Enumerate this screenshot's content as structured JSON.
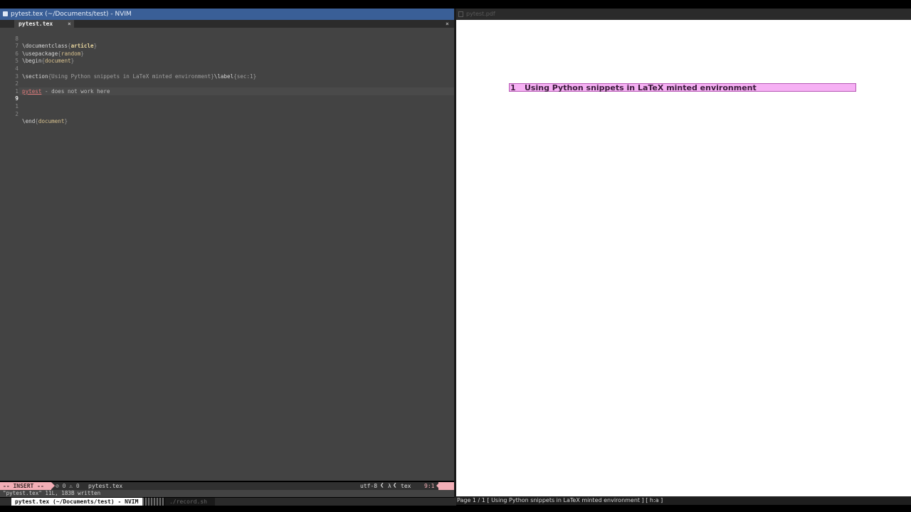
{
  "left_window": {
    "title": "pytest.tex (~/Documents/test) - NVIM",
    "tab_label": "pytest.tex",
    "tab_close": "×",
    "close_all": "×",
    "lines": [
      {
        "num": "8",
        "cmd": "\\documentclass",
        "open": "{",
        "arg": "article",
        "close": "}"
      },
      {
        "num": "7",
        "cmd": "\\usepackage",
        "open": "{",
        "arg": "random",
        "close": "}"
      },
      {
        "num": "6",
        "cmd": "\\begin",
        "open": "{",
        "arg": "document",
        "close": "}"
      },
      {
        "num": "5"
      },
      {
        "num": "4",
        "cmd": "\\section",
        "open": "{",
        "arg": "Using Python snippets in LaTeX minted environment",
        "close": "}",
        "cmd2": "\\label",
        "arg2": "{sec:1}"
      },
      {
        "num": "3"
      },
      {
        "num": "2",
        "err": "pytest",
        "text": " - does not work here"
      },
      {
        "num": "1"
      },
      {
        "num": "9"
      },
      {
        "num": "1"
      },
      {
        "num": "2",
        "cmd": "\\end",
        "open": "{",
        "arg": "document",
        "close": "}"
      }
    ],
    "status": {
      "mode": "-- INSERT --",
      "diagnostics": "⊘ 0 ⚠ 0",
      "filename": "pytest.tex",
      "encoding": "utf-8",
      "sep": "❮",
      "lambda": "λ",
      "filetype": "tex",
      "position": "9:1"
    },
    "cmdline": "\"pytest.tex\" 11L, 183B written"
  },
  "right_window": {
    "title": "pytest.pdf",
    "heading_number": "1",
    "heading_title": "Using Python snippets in LaTeX minted environment",
    "status": "Page 1 / 1 [ Using Python snippets in LaTeX minted environment ]  [ h:a ]"
  },
  "taskbar": {
    "active": "pytest.tex (~/Documents/test) - NVIM",
    "second": "./record.sh"
  }
}
